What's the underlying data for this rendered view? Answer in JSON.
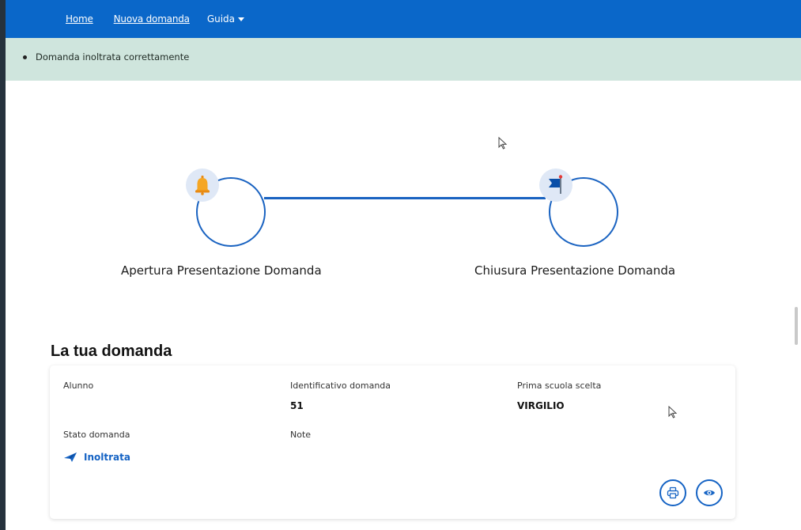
{
  "nav": {
    "home": "Home",
    "nuova_domanda": "Nuova domanda",
    "guida": "Guida"
  },
  "alert": {
    "message": "Domanda inoltrata correttamente"
  },
  "timeline": {
    "step1": "Apertura Presentazione Domanda",
    "step2": "Chiusura Presentazione Domanda"
  },
  "section": {
    "title": "La tua domanda"
  },
  "card": {
    "alunno_label": "Alunno",
    "alunno_value": "",
    "id_label": "Identificativo domanda",
    "id_value": "51",
    "scuola_label": "Prima scuola scelta",
    "scuola_value": "VIRGILIO",
    "stato_label": "Stato domanda",
    "stato_value": "Inoltrata",
    "note_label": "Note",
    "note_value": ""
  },
  "icons": {
    "bell": "bell-icon",
    "flag": "flag-icon",
    "send": "paper-plane-icon",
    "print": "print-icon",
    "view": "eye-icon"
  },
  "colors": {
    "navbar": "#0a67c9",
    "alert_bg": "#cfe5dd",
    "accent": "#1563c4",
    "bell": "#f5a623"
  }
}
